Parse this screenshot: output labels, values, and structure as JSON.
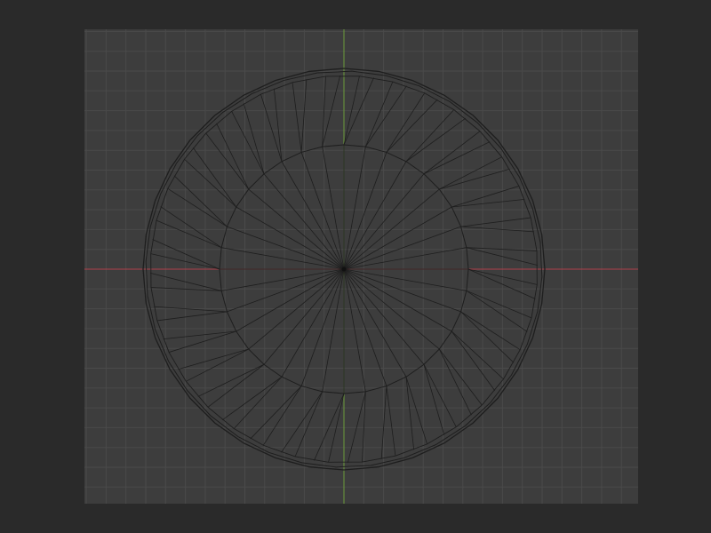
{
  "viewport": {
    "view": "top-orthographic",
    "background_color": "#3d3d3d",
    "grid_color": "#4a4a4a",
    "grid_visible": true,
    "x_axis_color": "#b0404a",
    "y_axis_color": "#6a9a3a",
    "wire_color": "#1e1e1e"
  },
  "mesh": {
    "type": "wireframe-disc",
    "segments": 36,
    "rings": [
      "outer-rim",
      "outer-rim-inner",
      "inner-circle",
      "center-pole"
    ]
  }
}
